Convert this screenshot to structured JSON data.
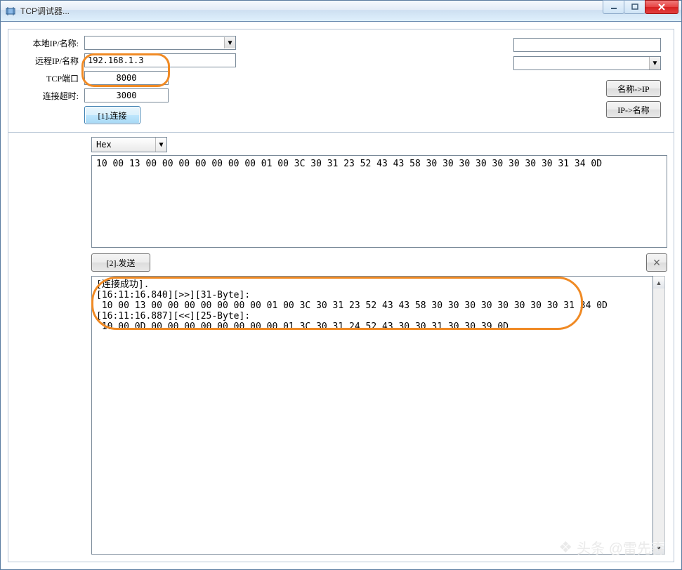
{
  "window": {
    "title": "TCP调试器..."
  },
  "connection": {
    "labels": {
      "local_ip": "本地IP/名称:",
      "remote_ip": "远程IP/名称",
      "tcp_port": "TCP端口",
      "timeout": "连接超时:"
    },
    "local_ip_value": "",
    "remote_ip_value": "192.168.1.3",
    "tcp_port_value": "8000",
    "timeout_value": "3000",
    "connect_btn": "[1].连接"
  },
  "lookup": {
    "name_to_ip_btn": "名称->IP",
    "ip_to_name_btn": "IP->名称"
  },
  "send": {
    "format": "Hex",
    "payload": "10 00 13 00 00 00 00 00 00 00 01 00 3C 30 31 23 52 43 43 58 30 30 30 30 30 30 30 30 31 34 0D",
    "send_btn": "[2].发送",
    "clear_icon": "×"
  },
  "log": {
    "lines": [
      "[连接成功].",
      "[16:11:16.840][>>][31-Byte]:",
      " 10 00 13 00 00 00 00 00 00 00 01 00 3C 30 31 23 52 43 43 58 30 30 30 30 30 30 30 30 31 34 0D",
      "[16:11:16.887][<<][25-Byte]:",
      " 10 00 0D 00 00 00 00 00 00 00 00 01 3C 30 31 24 52 43 30 30 31 30 30 39 0D"
    ]
  },
  "watermark": {
    "text": "头条 @雷先森"
  }
}
